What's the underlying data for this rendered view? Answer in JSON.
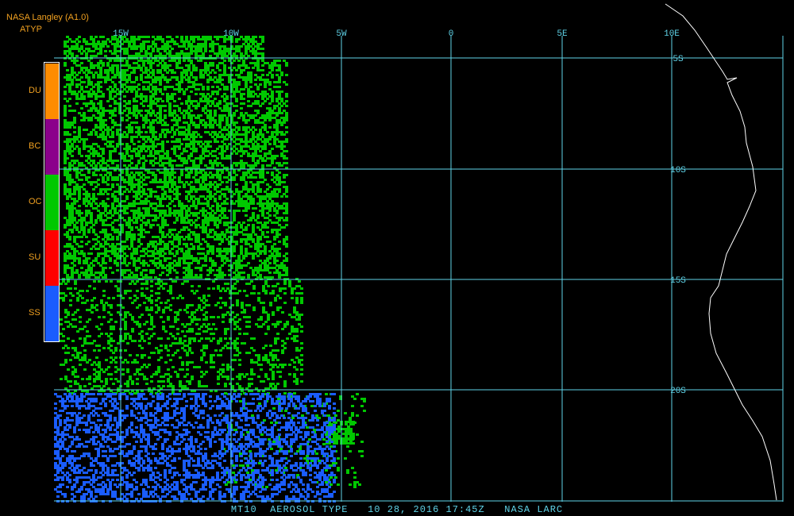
{
  "header": {
    "title": "NASA Langley (A1.0)",
    "product": "ATYP"
  },
  "legend": [
    {
      "code": "DU",
      "color": "#ff8c00"
    },
    {
      "code": "BC",
      "color": "#8b008b"
    },
    {
      "code": "OC",
      "color": "#00c800"
    },
    {
      "code": "SU",
      "color": "#ff0000"
    },
    {
      "code": "SS",
      "color": "#1a5cff"
    }
  ],
  "grid_color": "#5fd3e8",
  "coast_color": "#ffffff",
  "lon_labels": [
    "15W",
    "10W",
    "5W",
    "0",
    "5E",
    "10E"
  ],
  "lat_labels": [
    "5S",
    "10S",
    "15S",
    "20S"
  ],
  "footer": "MT10  AEROSOL TYPE   10 28, 2016 17:45Z   NASA LARC"
}
